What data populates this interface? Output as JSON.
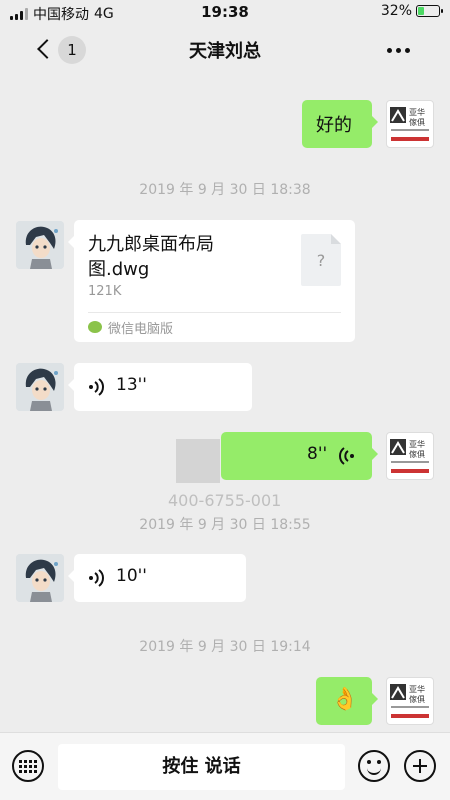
{
  "status_bar": {
    "carrier": "中国移动",
    "network": "4G",
    "time": "19:38",
    "battery_percent": "32%",
    "battery_level": 0.32
  },
  "nav": {
    "unread_count": "1",
    "title": "天津刘总"
  },
  "messages": {
    "m1_text": "好的",
    "ts1": "2019 年 9 月 30 日 18:38",
    "file_name": "九九郎桌面布局图.dwg",
    "file_name_line1": "九九郎桌面布局",
    "file_name_line2": "图.dwg",
    "file_size": "121K",
    "file_icon_char": "?",
    "file_source": "微信电脑版",
    "voice1_duration": "13''",
    "voice2_duration": "8''",
    "ts2": "2019 年 9 月 30 日 18:55",
    "voice3_duration": "10''",
    "ts3": "2019 年 9 月 30 日 19:14",
    "emoji": "👌"
  },
  "avatars": {
    "logo_cn_top": "亚华",
    "logo_cn_bottom": "傢俱"
  },
  "watermark": {
    "cn_line1": "亚华",
    "cn_line2": "傢俱",
    "phone": "400-6755-001"
  },
  "input_bar": {
    "hold_to_talk_label": "按住 说话"
  },
  "colors": {
    "bubble_green": "#95ec69",
    "bubble_white": "#ffffff",
    "background": "#ededed",
    "timestamp_gray": "#b0b0b0"
  }
}
